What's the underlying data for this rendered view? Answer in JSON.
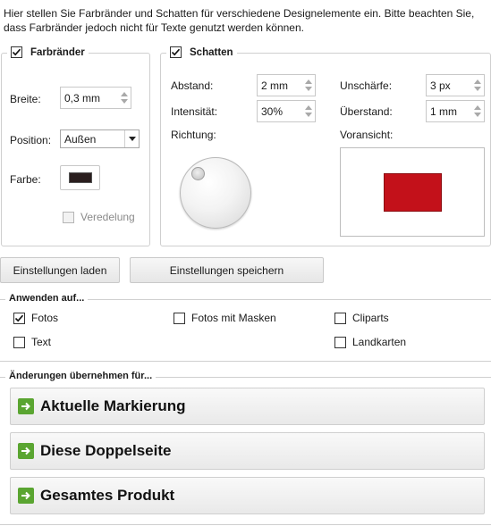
{
  "intro_text": "Hier stellen Sie Farbränder und Schatten für verschiedene Designelemente ein. Bitte beachten Sie, dass Farbränder jedoch nicht für Texte genutzt werden können.",
  "farbraender": {
    "title": "Farbränder",
    "checked": true,
    "breite_label": "Breite:",
    "breite_value": "0,3 mm",
    "position_label": "Position:",
    "position_value": "Außen",
    "farbe_label": "Farbe:",
    "farbe_color": "#2a1e1e",
    "veredelung_label": "Veredelung",
    "veredelung_checked": false
  },
  "schatten": {
    "title": "Schatten",
    "checked": true,
    "abstand_label": "Abstand:",
    "abstand_value": "2 mm",
    "intensitaet_label": "Intensität:",
    "intensitaet_value": "30%",
    "richtung_label": "Richtung:",
    "unschaerfe_label": "Unschärfe:",
    "unschaerfe_value": "3 px",
    "ueberstand_label": "Überstand:",
    "ueberstand_value": "1 mm",
    "voransicht_label": "Voransicht:",
    "preview_color": "#c3111a"
  },
  "buttons": {
    "load_label": "Einstellungen laden",
    "save_label": "Einstellungen speichern"
  },
  "apply_to": {
    "title": "Anwenden auf...",
    "fotos_label": "Fotos",
    "fotos_checked": true,
    "masken_label": "Fotos mit Masken",
    "masken_checked": false,
    "cliparts_label": "Cliparts",
    "cliparts_checked": false,
    "text_label": "Text",
    "text_checked": false,
    "landkarten_label": "Landkarten",
    "landkarten_checked": false
  },
  "commit": {
    "title": "Änderungen übernehmen für...",
    "aktuelle_label": "Aktuelle Markierung",
    "doppelseite_label": "Diese Doppelseite",
    "produkt_label": "Gesamtes Produkt"
  },
  "colors": {
    "accent_green": "#5aa531",
    "border": "#cfcfcf"
  }
}
